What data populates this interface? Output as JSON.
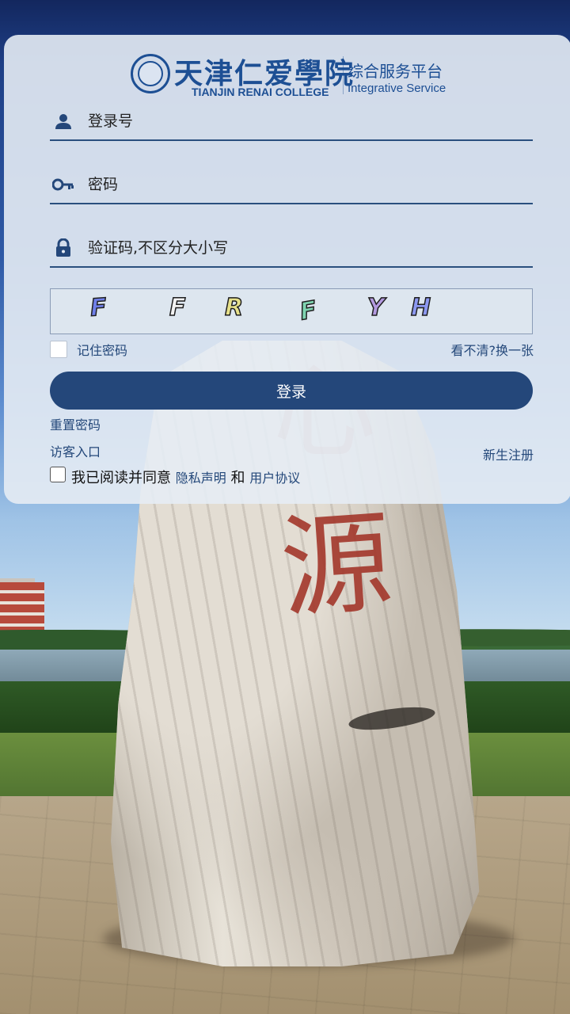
{
  "header": {
    "school_name_cn": "天津仁爱學院",
    "school_name_en": "TIANJIN RENAI COLLEGE",
    "platform_name_cn": "综合服务平台",
    "platform_name_en": "Integrative Service"
  },
  "form": {
    "username_placeholder": "登录号",
    "password_placeholder": "密码",
    "captcha_placeholder": "验证码,不区分大小写",
    "captcha_chars": [
      "F",
      "F",
      "R",
      "F",
      "Y",
      "H"
    ],
    "remember_label": "记住密码",
    "refresh_label": "看不清?换一张",
    "login_button": "登录"
  },
  "links": {
    "reset_password": "重置密码",
    "guest_entry": "访客入口",
    "new_student_register": "新生注册"
  },
  "agreement": {
    "prefix": "我已阅读并同意",
    "privacy": "隐私声明",
    "and": "和",
    "user_agreement": "用户协议"
  },
  "background": {
    "stone_char": "源"
  },
  "colors": {
    "accent": "#24477a",
    "brand": "#1d4f94"
  }
}
